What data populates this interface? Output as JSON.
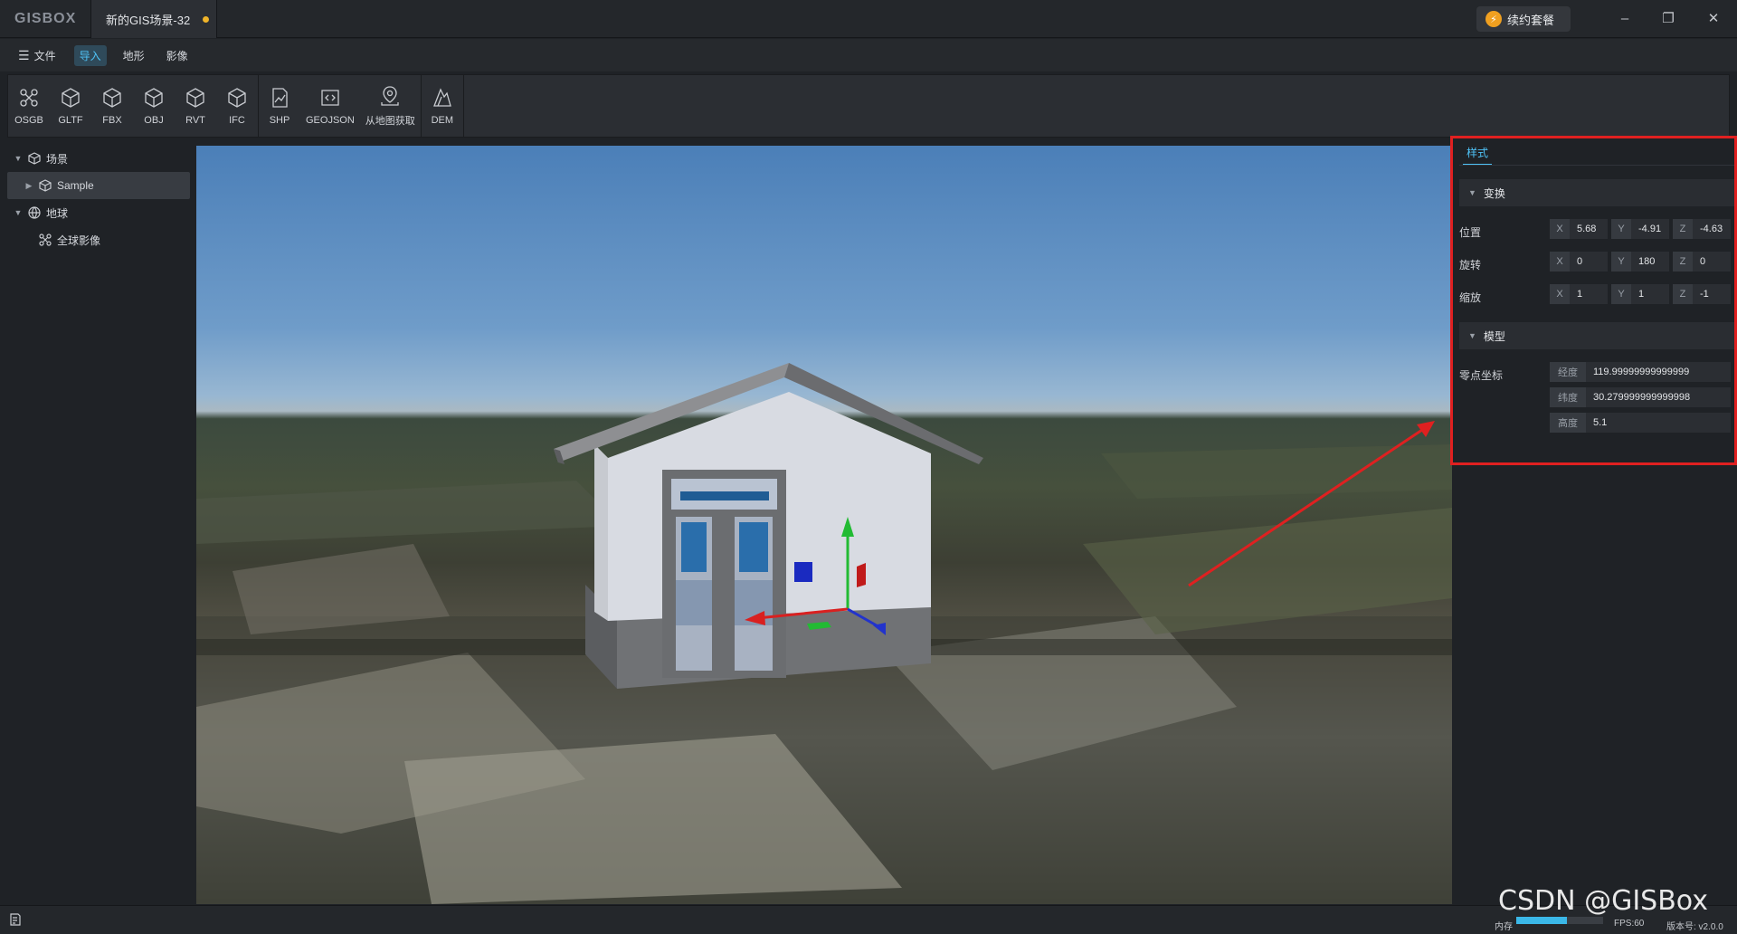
{
  "app": {
    "logo": "GISBOX",
    "doc_tab": "新的GIS场景-32",
    "renew_label": "续约套餐"
  },
  "window": {
    "minimize": "–",
    "restore": "❐",
    "close": "✕"
  },
  "menu": {
    "file_label": "文件",
    "tabs": [
      "导入",
      "地形",
      "影像"
    ],
    "active_tab": "导入"
  },
  "toolbar": {
    "groups": [
      [
        {
          "label": "OSGB",
          "icon": "osgb-icon"
        },
        {
          "label": "GLTF",
          "icon": "cube-icon"
        },
        {
          "label": "FBX",
          "icon": "cube-icon"
        },
        {
          "label": "OBJ",
          "icon": "cube-icon"
        },
        {
          "label": "RVT",
          "icon": "cube-icon"
        },
        {
          "label": "IFC",
          "icon": "cube-icon"
        }
      ],
      [
        {
          "label": "SHP",
          "icon": "shp-icon"
        },
        {
          "label": "GEOJSON",
          "icon": "geojson-icon"
        },
        {
          "label": "从地图获取",
          "icon": "map-pin-icon"
        }
      ],
      [
        {
          "label": "DEM",
          "icon": "dem-icon"
        }
      ]
    ]
  },
  "tree": {
    "scene_label": "场景",
    "sample_label": "Sample",
    "globe_label": "地球",
    "imagery_label": "全球影像"
  },
  "panel": {
    "tab_label": "样式",
    "transform_label": "变换",
    "position_label": "位置",
    "rotation_label": "旋转",
    "scale_label": "缩放",
    "position": {
      "x": "5.68",
      "y": "-4.91",
      "z": "-4.63"
    },
    "rotation": {
      "x": "0",
      "y": "180",
      "z": "0"
    },
    "scale": {
      "x": "1",
      "y": "1",
      "z": "-1"
    },
    "model_label": "模型",
    "origin_label": "零点坐标",
    "longitude_key": "经度",
    "longitude": "119.99999999999999",
    "latitude_key": "纬度",
    "latitude": "30.279999999999998",
    "height_key": "高度",
    "height": "5.1",
    "axis": {
      "x": "X",
      "y": "Y",
      "z": "Z"
    }
  },
  "status": {
    "memory_label": "内存",
    "memory_fraction": 0.58,
    "fps_label": "FPS:60",
    "version_label": "版本号: v2.0.0"
  },
  "watermark": "CSDN @GISBox",
  "colors": {
    "accent": "#4fc3f7",
    "highlight_box": "#e02020",
    "dirty_dot": "#f0b429"
  }
}
